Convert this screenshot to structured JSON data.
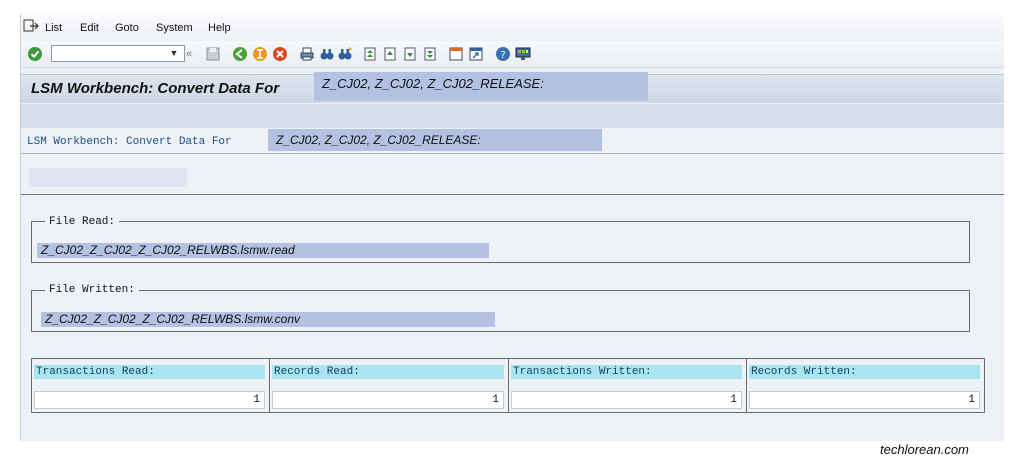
{
  "menu": {
    "items": [
      "List",
      "Edit",
      "Goto",
      "System",
      "Help"
    ]
  },
  "toolbar": {
    "command_value": ""
  },
  "title": {
    "prefix": "LSM Workbench: Convert Data For",
    "objects": "Z_CJ02, Z_CJ02, Z_CJ02_RELEASE:"
  },
  "list_header": {
    "prefix": "LSM Workbench: Convert Data For",
    "objects": "Z_CJ02, Z_CJ02, Z_CJ02_RELEASE:"
  },
  "file_read": {
    "label": "File Read:",
    "value": "Z_CJ02_Z_CJ02_Z_CJ02_RELWBS.lsmw.read"
  },
  "file_written": {
    "label": "File Written:",
    "value": "Z_CJ02_Z_CJ02_Z_CJ02_RELWBS.lsmw.conv"
  },
  "stats": [
    {
      "label": "Transactions Read:",
      "value": "1"
    },
    {
      "label": "Records Read:",
      "value": "1"
    },
    {
      "label": "Transactions Written:",
      "value": "1"
    },
    {
      "label": "Records Written:",
      "value": "1"
    }
  ],
  "watermark": "techlorean.com",
  "colors": {
    "highlight": "#b3c1e2",
    "header_cell": "#a9e4ef",
    "window_bg": "#eef2f6"
  }
}
